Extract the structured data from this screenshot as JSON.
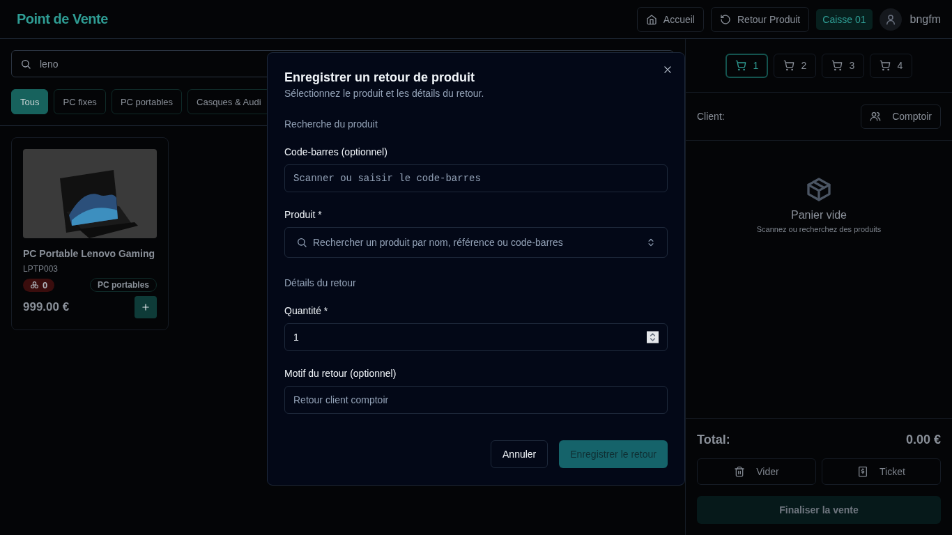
{
  "header": {
    "title": "Point de Vente",
    "nav_buttons": [
      {
        "kind": "home",
        "label": "Accueil"
      },
      {
        "kind": "return",
        "label": "Retour Produit"
      }
    ],
    "register": "Caisse 01",
    "user": "bngfm"
  },
  "search": {
    "value": "leno"
  },
  "categories": [
    {
      "label": "Tous",
      "selected": true
    },
    {
      "label": "PC fixes",
      "selected": false
    },
    {
      "label": "PC portables",
      "selected": false
    },
    {
      "label": "Casques & Audi",
      "selected": false
    }
  ],
  "products": [
    {
      "kind": "picture",
      "name": "PC Portable Lenovo Gaming",
      "sku": "LPTP003",
      "stock": "0",
      "out_of_stock": true,
      "category": "PC portables",
      "price": "999.00 €"
    }
  ],
  "cart": {
    "tabs": [
      {
        "label": "1",
        "selected": true
      },
      {
        "label": "2",
        "selected": false
      },
      {
        "label": "3",
        "selected": false
      },
      {
        "label": "4",
        "selected": false
      }
    ],
    "client_label": "Client:",
    "client_button": "Comptoir",
    "empty_title": "Panier vide",
    "empty_hint": "Scannez ou recherchez des produits",
    "total_label": "Total:",
    "total_value": "0.00 €",
    "actions": [
      {
        "kind": "clear",
        "label": "Vider"
      },
      {
        "kind": "receipt",
        "label": "Ticket"
      }
    ],
    "checkout": "Finaliser la vente"
  },
  "dialog": {
    "title": "Enregistrer un retour de produit",
    "subtitle": "Sélectionnez le produit et les détails du retour.",
    "items": [
      {
        "kind": "heading",
        "text": "Recherche du produit"
      },
      {
        "kind": "text-field",
        "label": "Code-barres (optionnel)",
        "placeholder": "Scanner ou saisir le code-barres",
        "mono": true
      },
      {
        "kind": "combobox",
        "label": "Produit *",
        "placeholder": "Rechercher un produit par nom, référence ou code-barres"
      },
      {
        "kind": "heading",
        "text": "Détails du retour"
      },
      {
        "kind": "number-field",
        "label": "Quantité *",
        "value": "1"
      },
      {
        "kind": "text-field",
        "label": "Motif du retour (optionnel)",
        "placeholder": "Retour client comptoir",
        "mono": false
      }
    ],
    "buttons": [
      {
        "kind": "secondary",
        "label": "Annuler"
      },
      {
        "kind": "primary",
        "label": "Enregistrer le retour"
      }
    ]
  }
}
